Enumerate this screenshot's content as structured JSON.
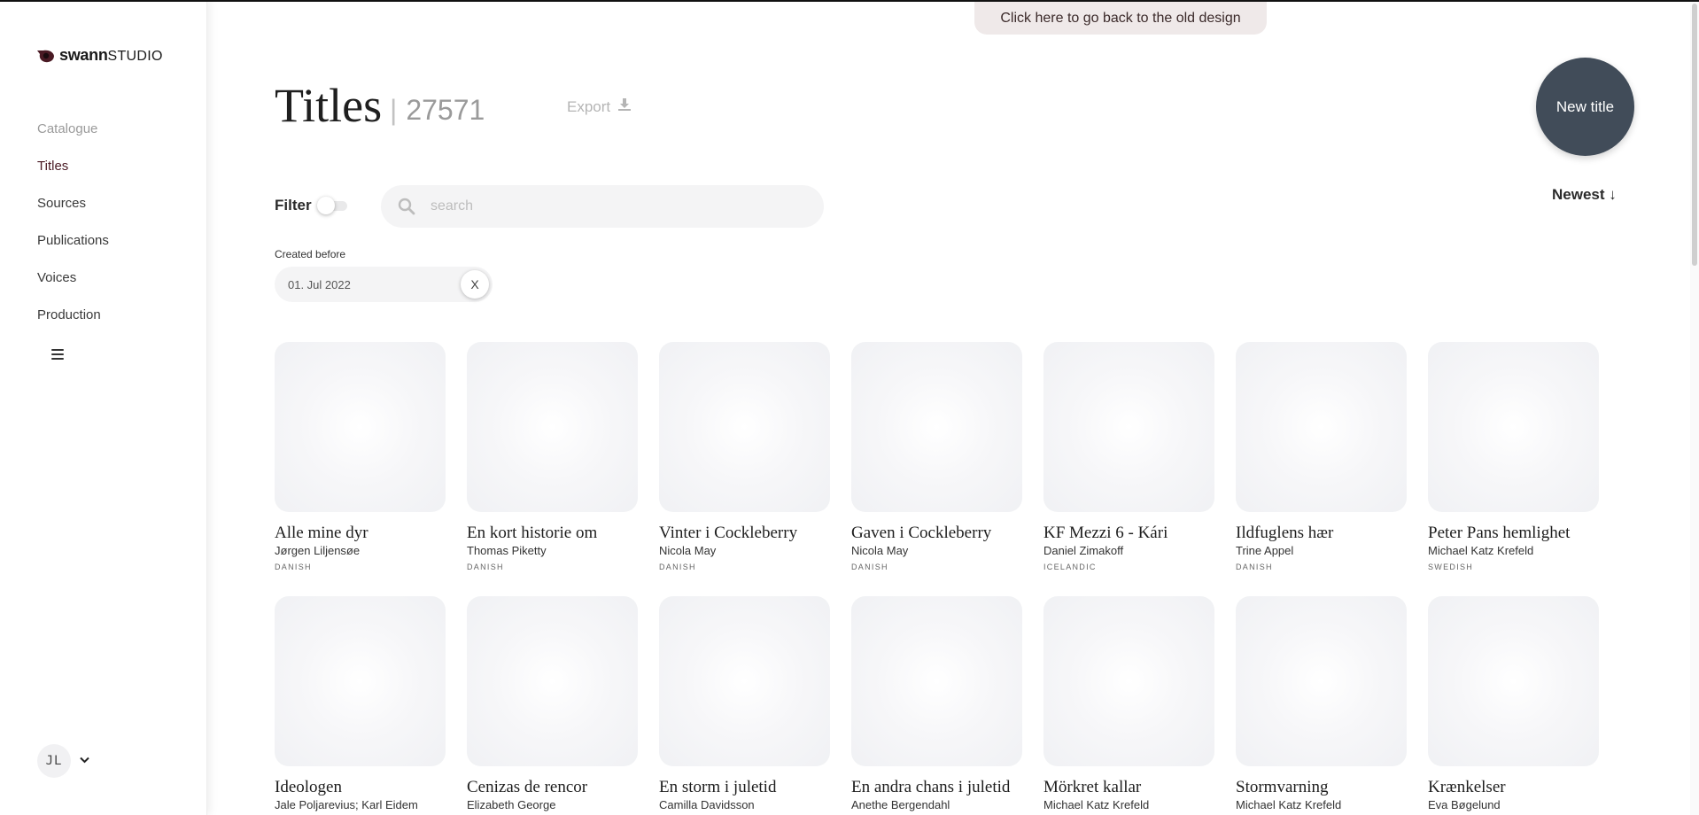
{
  "app": {
    "logo_bold": "swann",
    "logo_light": "STUDIO"
  },
  "banner": {
    "text": "Click here to go back to the old design"
  },
  "sidebar": {
    "items": [
      {
        "label": "Catalogue"
      },
      {
        "label": "Titles"
      },
      {
        "label": "Sources"
      },
      {
        "label": "Publications"
      },
      {
        "label": "Voices"
      },
      {
        "label": "Production"
      }
    ],
    "user_initials": "JL"
  },
  "header": {
    "title": "Titles",
    "count": "27571",
    "export_label": "Export",
    "new_title_label": "New title"
  },
  "filter": {
    "label": "Filter",
    "search_placeholder": "search",
    "sort_label": "Newest ↓",
    "created_before_label": "Created before",
    "created_before_value": "01. Jul 2022",
    "clear_label": "X"
  },
  "titles": [
    {
      "title": "Alle mine dyr",
      "author": "Jørgen Liljensøe",
      "language": "DANISH"
    },
    {
      "title": "En kort historie om",
      "author": "Thomas Piketty",
      "language": "DANISH"
    },
    {
      "title": "Vinter i Cockleberry",
      "author": "Nicola May",
      "language": "DANISH"
    },
    {
      "title": "Gaven i Cockleberry",
      "author": "Nicola May",
      "language": "DANISH"
    },
    {
      "title": "KF Mezzi 6 - Kári",
      "author": "Daniel Zimakoff",
      "language": "ICELANDIC"
    },
    {
      "title": "Ildfuglens hær",
      "author": "Trine Appel",
      "language": "DANISH"
    },
    {
      "title": "Peter Pans hemlighet",
      "author": "Michael Katz Krefeld",
      "language": "SWEDISH"
    },
    {
      "title": "Ideologen",
      "author": "Jale Poljarevius; Karl Eidem",
      "language": ""
    },
    {
      "title": "Cenizas de rencor",
      "author": "Elizabeth George",
      "language": ""
    },
    {
      "title": "En storm i juletid",
      "author": "Camilla Davidsson",
      "language": ""
    },
    {
      "title": "En andra chans i juletid",
      "author": "Anethe Bergendahl",
      "language": ""
    },
    {
      "title": "Mörkret kallar",
      "author": "Michael Katz Krefeld",
      "language": ""
    },
    {
      "title": "Stormvarning",
      "author": "Michael Katz Krefeld",
      "language": ""
    },
    {
      "title": "Krænkelser",
      "author": "Eva Bøgelund",
      "language": ""
    }
  ],
  "colors": {
    "accent_dark": "#414c59",
    "active_nav": "#4a1a24",
    "banner_bg": "#efe9e9"
  }
}
